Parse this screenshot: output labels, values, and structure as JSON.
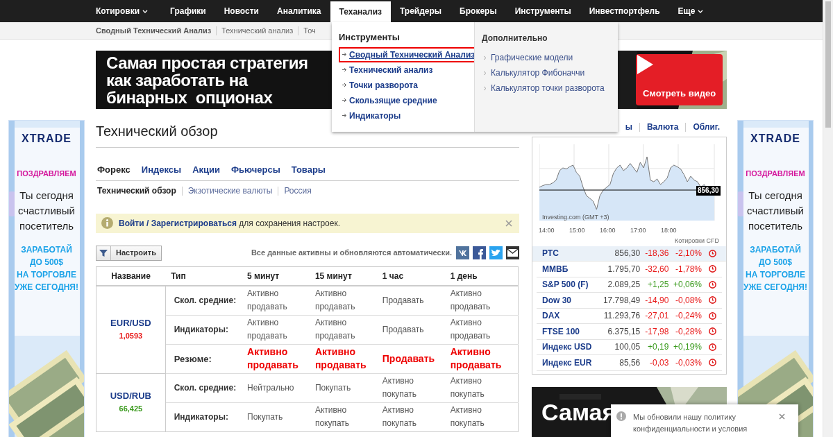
{
  "top_nav": {
    "items": [
      {
        "label": "Котировки",
        "dropdown": true,
        "selected": false
      },
      {
        "label": "Графики",
        "dropdown": false,
        "selected": false
      },
      {
        "label": "Новости",
        "dropdown": false,
        "selected": false
      },
      {
        "label": "Аналитика",
        "dropdown": false,
        "selected": false
      },
      {
        "label": "Теханализ",
        "dropdown": false,
        "selected": true
      },
      {
        "label": "Трейдеры",
        "dropdown": false,
        "selected": false
      },
      {
        "label": "Брокеры",
        "dropdown": false,
        "selected": false
      },
      {
        "label": "Инструменты",
        "dropdown": false,
        "selected": false
      },
      {
        "label": "Инвестпортфель",
        "dropdown": false,
        "selected": false
      },
      {
        "label": "Еще",
        "dropdown": true,
        "selected": false
      }
    ]
  },
  "sub_nav": {
    "items": [
      {
        "label": "Сводный Технический Анализ"
      },
      {
        "label": "Технический анализ"
      },
      {
        "label": "Точ"
      }
    ]
  },
  "mega_menu": {
    "columns": [
      {
        "heading": "Инструменты",
        "items": [
          {
            "label": "Сводный Технический Анализ",
            "selected": true
          },
          {
            "label": "Технический анализ",
            "selected": false
          },
          {
            "label": "Точки разворота",
            "selected": false
          },
          {
            "label": "Скользящие средние",
            "selected": false
          },
          {
            "label": "Индикаторы",
            "selected": false
          }
        ]
      },
      {
        "heading": "Дополнительно",
        "items": [
          {
            "label": "Графические модели",
            "selected": false
          },
          {
            "label": "Калькулятор Фибоначчи",
            "selected": false
          },
          {
            "label": "Калькулятор точки разворота",
            "selected": false
          }
        ]
      }
    ]
  },
  "banner": {
    "lines": [
      "Самая простая стратегия",
      "как заработать на",
      "бинарных  опционах"
    ],
    "button": "Смотреть видео"
  },
  "side_ads": [
    {
      "logo": "XTRADE",
      "headline": "ПОЗДРАВЛЯЕМ",
      "message_lines": [
        "Ты сегодня",
        "счастливый",
        "посетитель"
      ],
      "offer_lines": [
        "ЗАРАБОТАЙ",
        "ДО 500$",
        "НА ТОРГОВЛЕ",
        "УЖЕ СЕГОДНЯ!"
      ]
    },
    {
      "logo": "XTRADE",
      "headline": "ПОЗДРАВЛЯЕМ",
      "message_lines": [
        "Ты сегодня",
        "счастливый",
        "посетитель"
      ],
      "offer_lines": [
        "ЗАРАБОТАЙ",
        "ДО 500$",
        "НА ТОРГОВЛЕ",
        "УЖЕ СЕГОДНЯ!"
      ]
    }
  ],
  "page": {
    "title": "Технический обзор"
  },
  "tabs": [
    {
      "label": "Форекс",
      "selected": true
    },
    {
      "label": "Индексы",
      "selected": false
    },
    {
      "label": "Акции",
      "selected": false
    },
    {
      "label": "Фьючерсы",
      "selected": false
    },
    {
      "label": "Товары",
      "selected": false
    }
  ],
  "subtabs": [
    {
      "label": "Технический обзор",
      "selected": true
    },
    {
      "label": "Экзотические валюты",
      "selected": false
    },
    {
      "label": "Россия",
      "selected": false
    }
  ],
  "notice": {
    "links": [
      "Войти",
      "Зарегистрироваться"
    ],
    "separator": "/",
    "text": "для сохранения настроек."
  },
  "toolbar": {
    "button": "Настроить",
    "status": "Все данные активны и обновляются автоматически."
  },
  "table": {
    "columns": [
      "Название",
      "Тип",
      "5 минут",
      "15 минут",
      "1 час",
      "1 день"
    ],
    "groups": [
      {
        "pair": "EUR/USD",
        "price": "1,0593",
        "color": "#e81919",
        "rows": [
          {
            "kind": "normal",
            "type": "Скол. средние:",
            "signals": [
              "Активно продавать",
              "Активно продавать",
              "Продавать",
              "Активно продавать"
            ]
          },
          {
            "kind": "normal",
            "type": "Индикаторы:",
            "signals": [
              "Активно продавать",
              "Активно продавать",
              "Продавать",
              "Активно продавать"
            ]
          },
          {
            "kind": "summary",
            "type": "Резюме:",
            "signals": [
              "Активно продавать",
              "Активно продавать",
              "Продавать",
              "Активно продавать"
            ]
          }
        ]
      },
      {
        "pair": "USD/RUB",
        "price": "66,425",
        "color": "#3a9a1d",
        "rows": [
          {
            "kind": "normal",
            "type": "Скол. средние:",
            "signals": [
              "Нейтрально",
              "Покупать",
              "Активно покупать",
              "Активно покупать"
            ]
          },
          {
            "kind": "normal",
            "type": "Индикаторы:",
            "signals": [
              "Покупать",
              "Активно покупать",
              "Активно покупать",
              "Активно покупать"
            ]
          }
        ]
      }
    ]
  },
  "market": {
    "tabs": [
      {
        "label": "ы"
      },
      {
        "label": "Валюта"
      },
      {
        "label": "Облиг."
      }
    ],
    "chart": {
      "x_labels": [
        "14:00",
        "15:00",
        "16:00",
        "17:00",
        "18:00"
      ],
      "price": "856,30",
      "credit": "Investing.com (GMT +3)"
    },
    "note": "Котировки CFD",
    "quotes": [
      {
        "name": "РТС",
        "last": "856,30",
        "change": "-18,36",
        "percent": "-2,10%",
        "color": "#e81919",
        "selected": true
      },
      {
        "name": "ММВБ",
        "last": "1.795,70",
        "change": "-32,60",
        "percent": "-1,78%",
        "color": "#e81919",
        "selected": false
      },
      {
        "name": "S&P 500 (F)",
        "last": "2.089,25",
        "change": "+1,25",
        "percent": "+0,06%",
        "color": "#3a9a1d",
        "selected": false
      },
      {
        "name": "Dow 30",
        "last": "17.798,49",
        "change": "-14,90",
        "percent": "-0,08%",
        "color": "#e81919",
        "selected": false
      },
      {
        "name": "DAX",
        "last": "11.293,76",
        "change": "-27,01",
        "percent": "-0,24%",
        "color": "#e81919",
        "selected": false
      },
      {
        "name": "FTSE 100",
        "last": "6.375,15",
        "change": "-17,98",
        "percent": "-0,28%",
        "color": "#e81919",
        "selected": false
      },
      {
        "name": "Индекс USD",
        "last": "100,05",
        "change": "+0,19",
        "percent": "+0,19%",
        "color": "#3a9a1d",
        "selected": false
      },
      {
        "name": "Индекс EUR",
        "last": "85,56",
        "change": "-0,03",
        "percent": "-0,03%",
        "color": "#e81919",
        "selected": false
      }
    ]
  },
  "promo": {
    "text": "Самая"
  },
  "privacy_notice": {
    "text": "Мы обновили нашу политику конфиденциальности и условия"
  }
}
